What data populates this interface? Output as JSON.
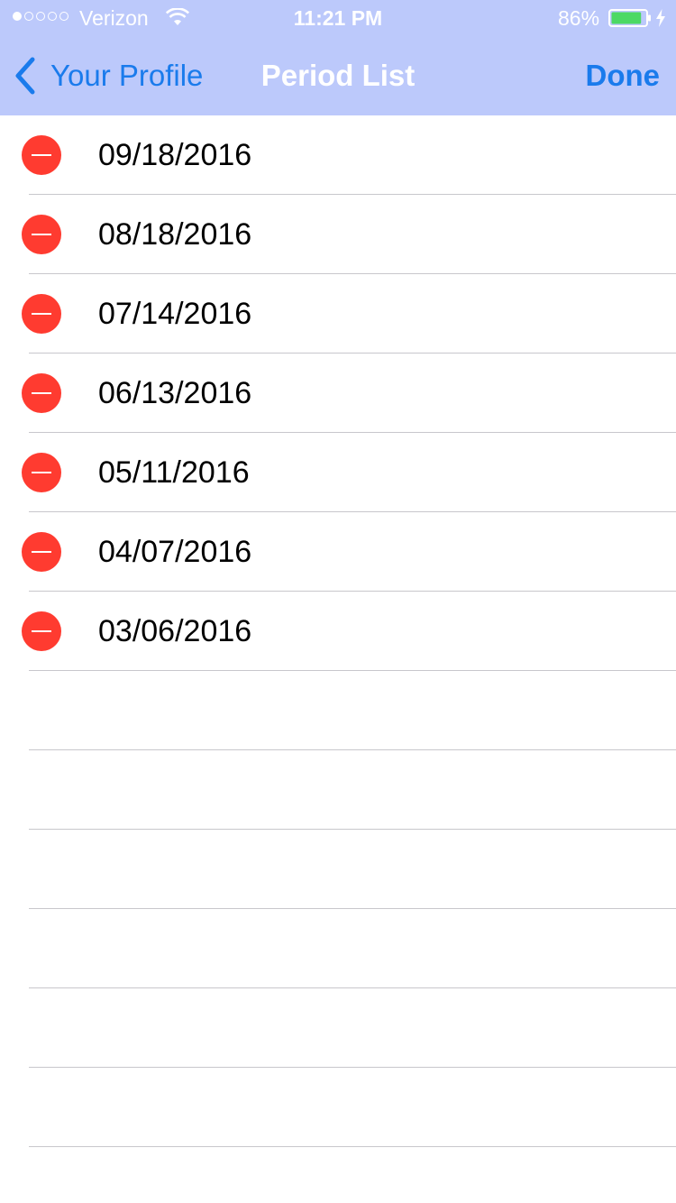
{
  "status_bar": {
    "signal_bars_filled": 1,
    "signal_bars_total": 5,
    "carrier": "Verizon",
    "wifi_icon": "wifi-icon",
    "time": "11:21 PM",
    "battery_percent": "86%",
    "battery_level": 0.86,
    "battery_color": "#4cd964",
    "charging_icon": "bolt-icon"
  },
  "nav": {
    "back_icon": "chevron-left-icon",
    "back_label": "Your Profile",
    "title": "Period List",
    "done_label": "Done"
  },
  "colors": {
    "nav_background": "#bcc9fb",
    "tint": "#1a7bec",
    "delete": "#ff3b30",
    "separator": "#c8c7cc"
  },
  "periods": [
    {
      "date": "09/18/2016"
    },
    {
      "date": "08/18/2016"
    },
    {
      "date": "07/14/2016"
    },
    {
      "date": "06/13/2016"
    },
    {
      "date": "05/11/2016"
    },
    {
      "date": "04/07/2016"
    },
    {
      "date": "03/06/2016"
    }
  ],
  "empty_rows": 6
}
